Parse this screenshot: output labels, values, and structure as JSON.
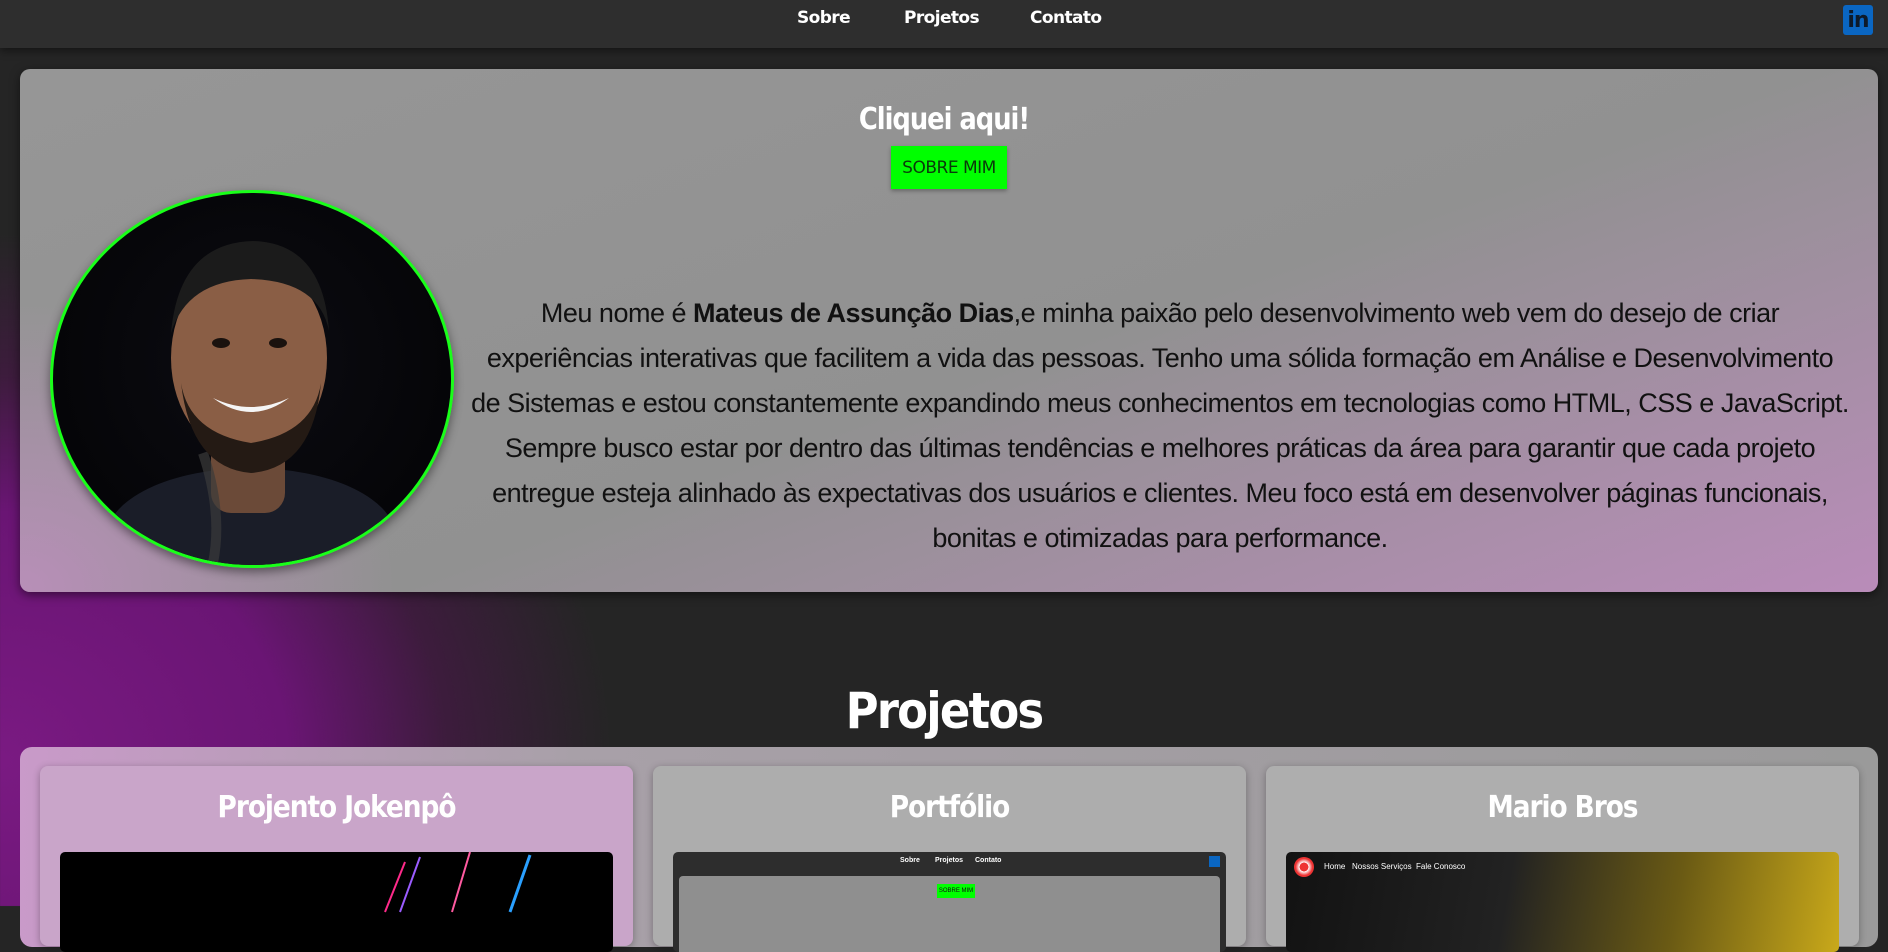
{
  "nav": {
    "sobre": "Sobre",
    "projetos": "Projetos",
    "contato": "Contato",
    "linkedin_glyph": "in"
  },
  "about": {
    "cta_title": "Cliquei aqui!",
    "cta_button": "SOBRE MIM",
    "bio_prefix": "Meu nome é ",
    "bio_name": "Mateus de Assunção Dias",
    "bio_rest": ",e minha paixão pelo desenvolvimento web vem do desejo de criar experiências interativas que facilitem a vida das pessoas. Tenho uma sólida formação em Análise e Desenvolvimento de Sistemas e estou constantemente expandindo meus conhecimentos em tecnologias como HTML, CSS e JavaScript. Sempre busco estar por dentro das últimas tendências e melhores práticas da área para garantir que cada projeto entregue esteja alinhado às expectativas dos usuários e clientes. Meu foco está em desenvolver páginas funcionais, bonitas e otimizadas para performance."
  },
  "projects": {
    "heading": "Projetos",
    "cards": [
      {
        "title": "Projento Jokenpô"
      },
      {
        "title": "Portfólio",
        "thumb_nav": [
          "Sobre",
          "Projetos",
          "Contato"
        ],
        "thumb_button": "SOBRE MIM"
      },
      {
        "title": "Mario Bros",
        "thumb_nav": [
          "Home",
          "Nossos Serviços",
          "Fale Conosco"
        ]
      }
    ]
  },
  "colors": {
    "accent_green": "#00ff00",
    "linkedin_blue": "#0a66c2",
    "purple_glow": "#7a1a82",
    "topbar": "#2e2e2e"
  }
}
